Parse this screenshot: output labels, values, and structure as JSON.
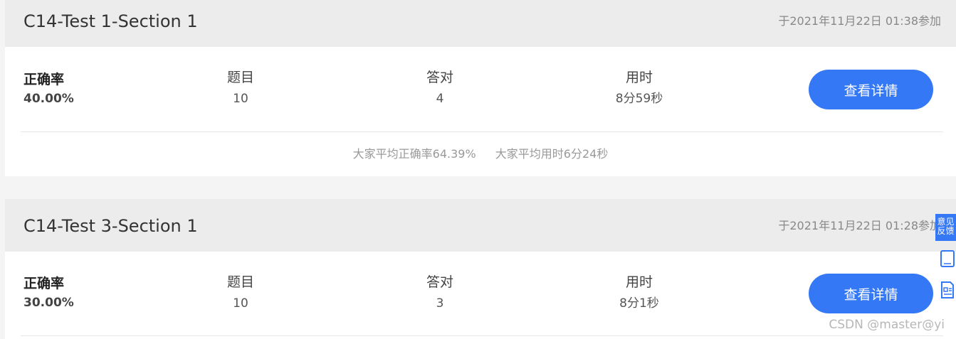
{
  "records": [
    {
      "title": "C14-Test 1-Section 1",
      "date": "于2021年11月22日 01:38参加",
      "accuracy_label": "正确率",
      "accuracy_value": "40.00%",
      "questions_label": "题目",
      "questions_value": "10",
      "correct_label": "答对",
      "correct_value": "4",
      "time_label": "用时",
      "time_value": "8分59秒",
      "button_label": "查看详情",
      "avg_accuracy": "大家平均正确率64.39%",
      "avg_time": "大家平均用时6分24秒"
    },
    {
      "title": "C14-Test 3-Section 1",
      "date": "于2021年11月22日 01:28参加",
      "accuracy_label": "正确率",
      "accuracy_value": "30.00%",
      "questions_label": "题目",
      "questions_value": "10",
      "correct_label": "答对",
      "correct_value": "3",
      "time_label": "用时",
      "time_value": "8分1秒",
      "button_label": "查看详情"
    }
  ],
  "side_tools": {
    "feedback_label": "意见反馈",
    "icons": [
      "tablet-icon",
      "document-icon"
    ]
  },
  "watermark": "CSDN @master@yi",
  "colors": {
    "accent": "#3478f6",
    "header_bg": "#ececec",
    "page_bg": "#f4f4f4"
  }
}
